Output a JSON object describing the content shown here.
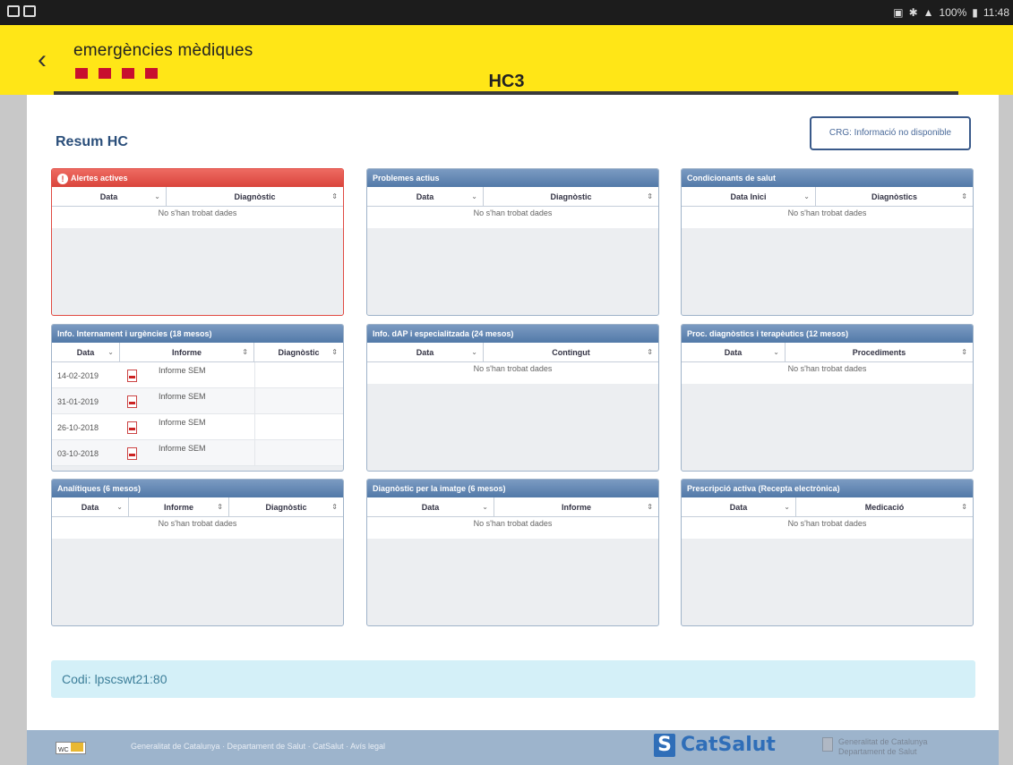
{
  "status_bar": {
    "right_text": "100%",
    "time": "11:48"
  },
  "header": {
    "brand_name": "emergències mèdiques",
    "title": "HC3"
  },
  "page": {
    "title": "Resum HC",
    "crg_button": "CRG: Informació no disponible"
  },
  "panels": [
    {
      "title": "Alertes actives",
      "alert": true,
      "columns": [
        "Data",
        "Diagnòstic"
      ],
      "empty": "No s'han trobat dades"
    },
    {
      "title": "Problemes actius",
      "columns": [
        "Data",
        "Diagnòstic"
      ],
      "empty": "No s'han trobat dades"
    },
    {
      "title": "Condicionants de salut",
      "columns": [
        "Data Inici",
        "Diagnòstics"
      ],
      "empty": "No s'han trobat dades"
    },
    {
      "title": "Info. Internament i urgències (18 mesos)",
      "columns": [
        "Data",
        "Informe",
        "Diagnòstic"
      ],
      "rows": [
        {
          "date": "14-02-2019",
          "report": "Informe SEM"
        },
        {
          "date": "31-01-2019",
          "report": "Informe SEM"
        },
        {
          "date": "26-10-2018",
          "report": "Informe SEM"
        },
        {
          "date": "03-10-2018",
          "report": "Informe SEM"
        }
      ]
    },
    {
      "title": "Info. dAP i especialitzada (24 mesos)",
      "columns": [
        "Data",
        "Contingut"
      ],
      "empty": "No s'han trobat dades"
    },
    {
      "title": "Proc. diagnòstics i terapèutics (12 mesos)",
      "columns": [
        "Data",
        "Procediments"
      ],
      "empty": "No s'han trobat dades"
    },
    {
      "title": "Analítiques (6 mesos)",
      "columns": [
        "Data",
        "Informe",
        "Diagnòstic"
      ],
      "empty": "No s'han trobat dades"
    },
    {
      "title": "Diagnòstic per la imatge (6 mesos)",
      "columns": [
        "Data",
        "Informe"
      ],
      "empty": "No s'han trobat dades"
    },
    {
      "title": "Prescripció activa (Recepta electrònica)",
      "columns": [
        "Data",
        "Medicació"
      ],
      "empty": "No s'han trobat dades"
    }
  ],
  "codi": "Codi: lpscswt21:80",
  "footer": {
    "links": "Generalitat de Catalunya · Departament de Salut · CatSalut · Avís legal",
    "catsalut": "CatSalut",
    "gen_line1": "Generalitat de Catalunya",
    "gen_line2": "Departament de Salut"
  }
}
